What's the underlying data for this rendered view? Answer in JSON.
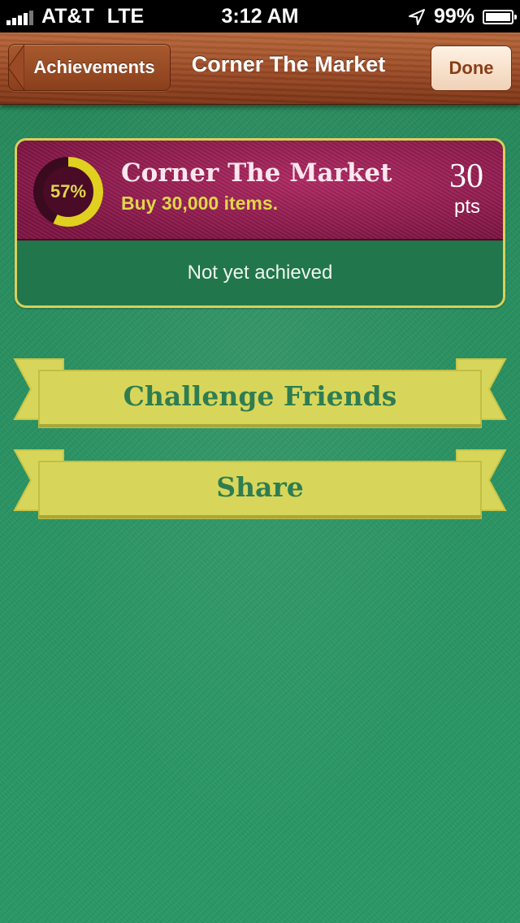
{
  "status_bar": {
    "carrier": "AT&T",
    "network": "LTE",
    "time": "3:12 AM",
    "battery": "99%",
    "battery_level": 0.99,
    "icons": [
      "signal-icon",
      "location-arrow-icon",
      "battery-icon"
    ]
  },
  "nav": {
    "back_label": "Achievements",
    "title": "Corner The Market",
    "done_label": "Done"
  },
  "achievement": {
    "progress_text": "57%",
    "progress": 0.57,
    "title": "Corner The Market",
    "description": "Buy 30,000 items.",
    "points": "30",
    "points_label": "pts",
    "status": "Not yet achieved"
  },
  "actions": {
    "challenge_label": "Challenge Friends",
    "share_label": "Share"
  },
  "colors": {
    "felt": "#2a9564",
    "wood": "#9a4a25",
    "card_header": "#9c1f55",
    "accent_yellow": "#e0d64a",
    "ribbon": "#d8d65a",
    "ribbon_text": "#2e7d52"
  }
}
